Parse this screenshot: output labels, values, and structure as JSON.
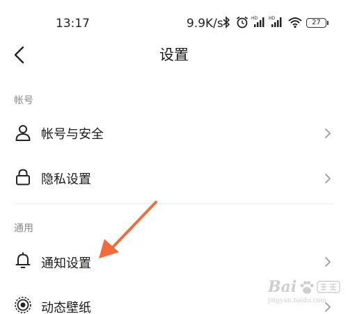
{
  "status_bar": {
    "time": "13:17",
    "net_speed": "9.9K/s",
    "battery": "27",
    "icons": [
      "bluetooth-icon",
      "alarm-icon",
      "signal-hd-icon",
      "signal-hd-icon",
      "wifi-icon",
      "battery-icon"
    ]
  },
  "header": {
    "title": "设置",
    "back_icon": "chevron-left-icon"
  },
  "sections": [
    {
      "title": "帐号",
      "items": [
        {
          "label": "帐号与安全",
          "icon": "person-icon"
        },
        {
          "label": "隐私设置",
          "icon": "lock-icon"
        }
      ]
    },
    {
      "title": "通用",
      "items": [
        {
          "label": "通知设置",
          "icon": "bell-icon"
        },
        {
          "label": "动态壁纸",
          "icon": "wallpaper-icon"
        }
      ]
    }
  ],
  "annotation": {
    "arrow_color": "#F26B3A"
  },
  "watermark": {
    "brand": "Bai",
    "site": "jingyan.baidu.com"
  }
}
